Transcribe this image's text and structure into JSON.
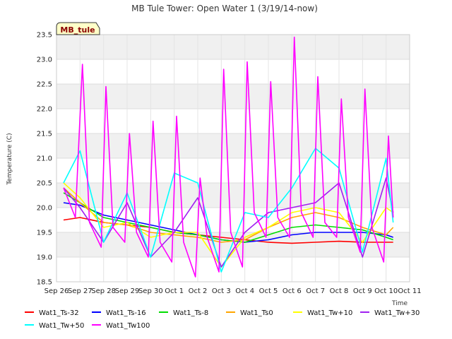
{
  "chart_data": {
    "type": "line",
    "title": "MB Tule Tower: Open Water 1 (3/19/14-now)",
    "xlabel": "Time",
    "ylabel": "Temperature (C)",
    "station_label": "MB_tule",
    "x_ticks": [
      "Sep 26",
      "Sep 27",
      "Sep 28",
      "Sep 29",
      "Sep 30",
      "Oct 1",
      "Oct 2",
      "Oct 3",
      "Oct 4",
      "Oct 5",
      "Oct 6",
      "Oct 7",
      "Oct 8",
      "Oct 9",
      "Oct 10",
      "Oct 11"
    ],
    "xlim": [
      0,
      15
    ],
    "ylim": [
      18.5,
      23.5
    ],
    "y_ticks": [
      "18.5",
      "19.0",
      "19.5",
      "20.0",
      "20.5",
      "21.0",
      "21.5",
      "22.0",
      "22.5",
      "23.0",
      "23.5"
    ],
    "grid": true,
    "band_shading": true,
    "legend_placement": "bottom",
    "series": [
      {
        "name": "Wat1_Ts-32",
        "color": "#ff0000",
        "x": [
          0.3,
          1,
          2,
          3,
          4,
          5,
          6,
          7,
          8,
          9,
          10,
          11,
          12,
          13,
          14,
          14.3
        ],
        "y": [
          19.75,
          19.8,
          19.7,
          19.65,
          19.6,
          19.5,
          19.45,
          19.4,
          19.35,
          19.3,
          19.28,
          19.3,
          19.32,
          19.3,
          19.3,
          19.3
        ]
      },
      {
        "name": "Wat1_Ts-16",
        "color": "#0000ff",
        "x": [
          0.3,
          1,
          2,
          3,
          4,
          5,
          6,
          7,
          8,
          9,
          10,
          11,
          12,
          13,
          14,
          14.3
        ],
        "y": [
          20.1,
          20.05,
          19.85,
          19.75,
          19.65,
          19.55,
          19.45,
          19.35,
          19.3,
          19.35,
          19.45,
          19.5,
          19.5,
          19.5,
          19.45,
          19.4
        ]
      },
      {
        "name": "Wat1_Ts-8",
        "color": "#00dd00",
        "x": [
          0.3,
          1,
          2,
          3,
          4,
          5,
          6,
          7,
          8,
          9,
          10,
          11,
          12,
          13,
          14,
          14.3
        ],
        "y": [
          20.3,
          20.1,
          19.8,
          19.7,
          19.6,
          19.5,
          19.45,
          19.35,
          19.3,
          19.45,
          19.6,
          19.65,
          19.6,
          19.55,
          19.4,
          19.35
        ]
      },
      {
        "name": "Wat1_Ts0",
        "color": "#ffa500",
        "x": [
          0.3,
          1,
          2,
          3,
          4,
          5,
          6,
          7,
          8,
          9,
          10,
          11,
          12,
          13,
          14,
          14.3
        ],
        "y": [
          20.4,
          20.1,
          19.7,
          19.65,
          19.5,
          19.45,
          19.4,
          19.3,
          19.35,
          19.6,
          19.8,
          19.9,
          19.8,
          19.6,
          19.45,
          19.6
        ]
      },
      {
        "name": "Wat1_Tw+10",
        "color": "#ffff00",
        "x": [
          0.3,
          1,
          2,
          3,
          4,
          5,
          6,
          7,
          8,
          9,
          10,
          11,
          12,
          13,
          14,
          14.3
        ],
        "y": [
          20.5,
          20.2,
          19.6,
          19.7,
          19.4,
          19.5,
          19.5,
          18.8,
          19.4,
          19.6,
          19.9,
          20.0,
          19.9,
          19.3,
          20.0,
          19.9
        ]
      },
      {
        "name": "Wat1_Tw+30",
        "color": "#a020f0",
        "x": [
          0.3,
          1,
          2,
          3,
          4,
          5,
          6,
          7,
          8,
          9,
          10,
          11,
          12,
          13,
          14,
          14.3
        ],
        "y": [
          20.4,
          20.0,
          19.3,
          20.1,
          19.0,
          19.5,
          20.2,
          18.8,
          19.5,
          19.9,
          20.0,
          20.1,
          20.5,
          19.0,
          20.6,
          19.9
        ]
      },
      {
        "name": "Wat1_Tw+50",
        "color": "#00ffff",
        "x": [
          0.3,
          1,
          2,
          3,
          4,
          5,
          6,
          7,
          8,
          9,
          10,
          11,
          12,
          13,
          14,
          14.3
        ],
        "y": [
          20.5,
          21.15,
          19.3,
          20.3,
          19.0,
          20.7,
          20.5,
          18.7,
          19.9,
          19.8,
          20.4,
          21.2,
          20.8,
          19.1,
          21.0,
          19.7
        ]
      },
      {
        "name": "Wat1_Tw100",
        "color": "#ff00ff",
        "x": [
          0.3,
          0.8,
          1.1,
          1.4,
          1.9,
          2.1,
          2.4,
          2.9,
          3.1,
          3.4,
          3.9,
          4.1,
          4.4,
          4.9,
          5.1,
          5.4,
          5.9,
          6.1,
          6.4,
          6.9,
          7.1,
          7.4,
          7.9,
          8.1,
          8.4,
          8.9,
          9.1,
          9.4,
          9.9,
          10.1,
          10.4,
          10.9,
          11.1,
          11.4,
          11.9,
          12.1,
          12.4,
          12.9,
          13.1,
          13.4,
          13.9,
          14.1,
          14.3
        ],
        "y": [
          20.4,
          19.8,
          22.9,
          19.7,
          19.2,
          22.45,
          19.6,
          19.3,
          21.5,
          19.5,
          19.0,
          21.75,
          19.3,
          18.9,
          21.85,
          19.3,
          18.6,
          20.6,
          19.4,
          18.7,
          22.8,
          19.5,
          18.8,
          22.95,
          19.9,
          19.4,
          22.55,
          19.8,
          19.4,
          23.45,
          19.9,
          19.4,
          22.65,
          19.7,
          19.4,
          22.2,
          19.8,
          19.1,
          22.4,
          19.6,
          18.9,
          21.45,
          19.8
        ]
      }
    ]
  }
}
